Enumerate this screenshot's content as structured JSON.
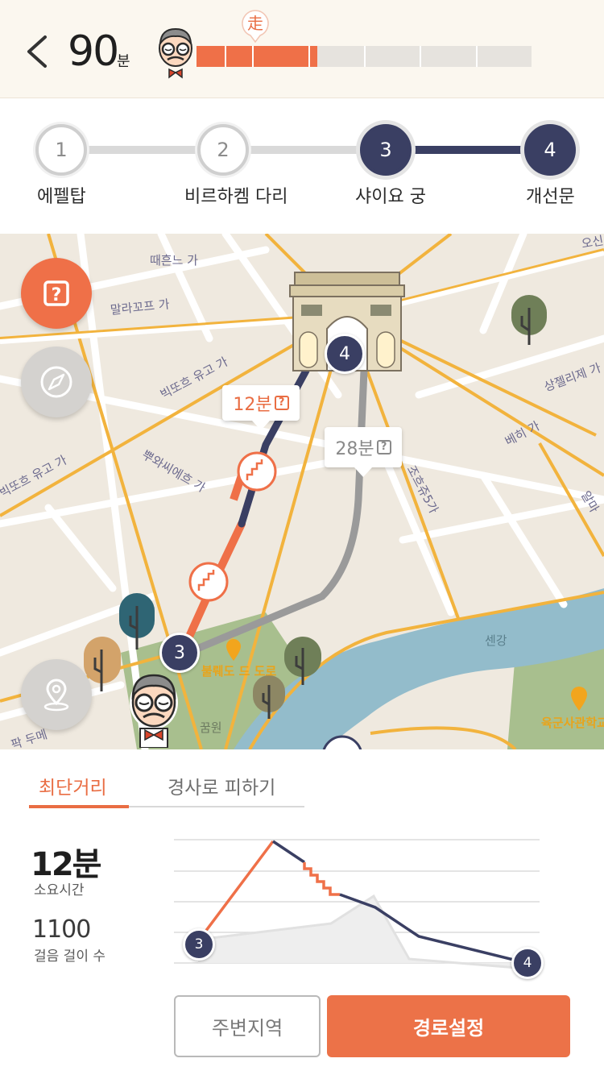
{
  "header": {
    "time_value": "90",
    "time_unit": "분",
    "walk_marker_label": "走",
    "progress": 0.36,
    "progress_segments": 6
  },
  "stepper": {
    "steps": [
      {
        "number": "1",
        "label": "에펠탑",
        "state": "inactive"
      },
      {
        "number": "2",
        "label": "비르하켐 다리",
        "state": "inactive"
      },
      {
        "number": "3",
        "label": "샤이요 궁",
        "state": "active"
      },
      {
        "number": "4",
        "label": "개선문",
        "state": "active"
      }
    ]
  },
  "map": {
    "streets": [
      "때흔느 가",
      "말라꼬프 가",
      "빅또흐 유고 가",
      "뿌와씨에흐 가",
      "빅또흐 유고 가",
      "상젤리제 가",
      "베히 가",
      "조흐쥬5가",
      "알마",
      "오신",
      "센강",
      "꿈원",
      "불뤠도 드 도로",
      "팍 두메"
    ],
    "callouts": [
      {
        "time": "12분",
        "color": "#e96d43"
      },
      {
        "time": "28분",
        "color": "#8a8a8a"
      }
    ],
    "nodes": [
      "3",
      "4"
    ],
    "poi_labels": [
      "육군사관학교"
    ],
    "colors": {
      "route_shortest": "#ef7048",
      "route_shortest_dark": "#3a3f63",
      "route_alt": "#9a9a9a",
      "river": "#93bccb",
      "park": "#a8bf8e",
      "road_major": "#f2b33d"
    }
  },
  "panel": {
    "tabs": [
      {
        "label": "최단거리",
        "active": true
      },
      {
        "label": "경사로 피하기",
        "active": false
      }
    ],
    "duration_value": "12분",
    "duration_label": "소요시간",
    "steps_value": "1100",
    "steps_label": "걸음 걸이 수",
    "chart_nodes": [
      "3",
      "4"
    ],
    "buttons": {
      "nearby": "주변지역",
      "set_route": "경로설정"
    }
  }
}
